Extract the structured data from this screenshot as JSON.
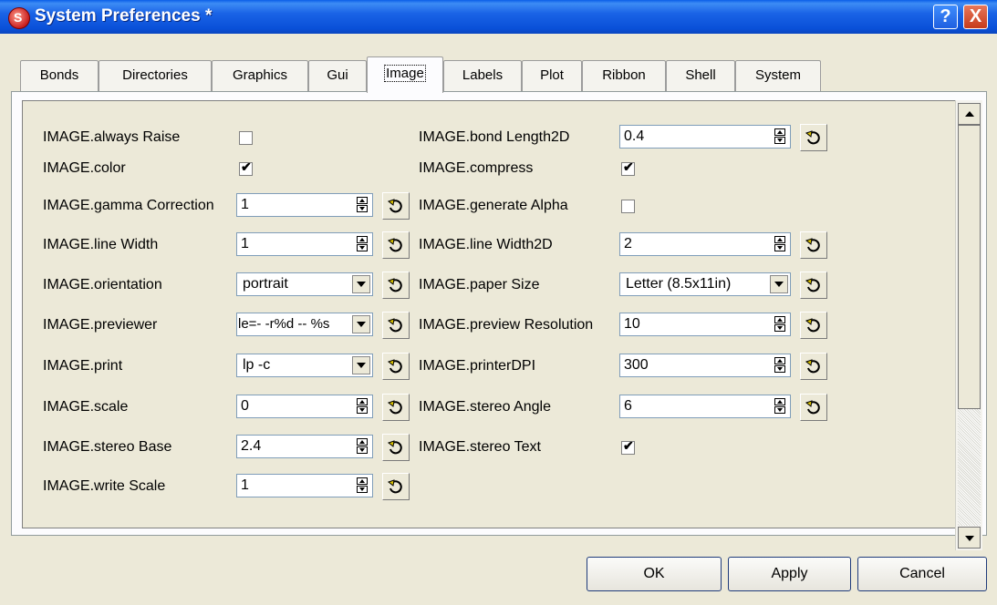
{
  "window": {
    "title": "System Preferences *",
    "app_icon_letter": "S"
  },
  "titlebar": {
    "help_glyph": "?",
    "close_glyph": "X"
  },
  "tabs": [
    {
      "label": "Bonds"
    },
    {
      "label": "Directories"
    },
    {
      "label": "Graphics"
    },
    {
      "label": "Gui"
    },
    {
      "label": "Image",
      "active": true
    },
    {
      "label": "Labels"
    },
    {
      "label": "Plot"
    },
    {
      "label": "Ribbon"
    },
    {
      "label": "Shell"
    },
    {
      "label": "System"
    }
  ],
  "left": {
    "always_raise": {
      "label": "IMAGE.always Raise",
      "checked": false
    },
    "color": {
      "label": "IMAGE.color",
      "checked": true
    },
    "gamma_correction": {
      "label": "IMAGE.gamma Correction",
      "value": "1"
    },
    "line_width": {
      "label": "IMAGE.line Width",
      "value": "1"
    },
    "orientation": {
      "label": "IMAGE.orientation",
      "value": "portrait"
    },
    "previewer": {
      "label": "IMAGE.previewer",
      "value": "le=- -r%d -- %s"
    },
    "print": {
      "label": "IMAGE.print",
      "value": "lp -c"
    },
    "scale": {
      "label": "IMAGE.scale",
      "value": "0"
    },
    "stereo_base": {
      "label": "IMAGE.stereo Base",
      "value": "2.4"
    },
    "write_scale": {
      "label": "IMAGE.write Scale",
      "value": "1"
    }
  },
  "right": {
    "bond_length2d": {
      "label": "IMAGE.bond Length2D",
      "value": "0.4"
    },
    "compress": {
      "label": "IMAGE.compress",
      "checked": true
    },
    "generate_alpha": {
      "label": "IMAGE.generate Alpha",
      "checked": false
    },
    "line_width2d": {
      "label": "IMAGE.line Width2D",
      "value": "2"
    },
    "paper_size": {
      "label": "IMAGE.paper Size",
      "value": "Letter (8.5x11in)"
    },
    "preview_resolution": {
      "label": "IMAGE.preview Resolution",
      "value": "10"
    },
    "printer_dpi": {
      "label": "IMAGE.printerDPI",
      "value": "300"
    },
    "stereo_angle": {
      "label": "IMAGE.stereo Angle",
      "value": "6"
    },
    "stereo_text": {
      "label": "IMAGE.stereo Text",
      "checked": true
    }
  },
  "check_mark": "✔",
  "buttons": {
    "ok": "OK",
    "apply": "Apply",
    "cancel": "Cancel"
  },
  "colors": {
    "titlebar": "#0a5fe8",
    "background": "#ece9d8",
    "close": "#c63b1b"
  },
  "icons": {
    "reset": "reset-default-icon"
  }
}
